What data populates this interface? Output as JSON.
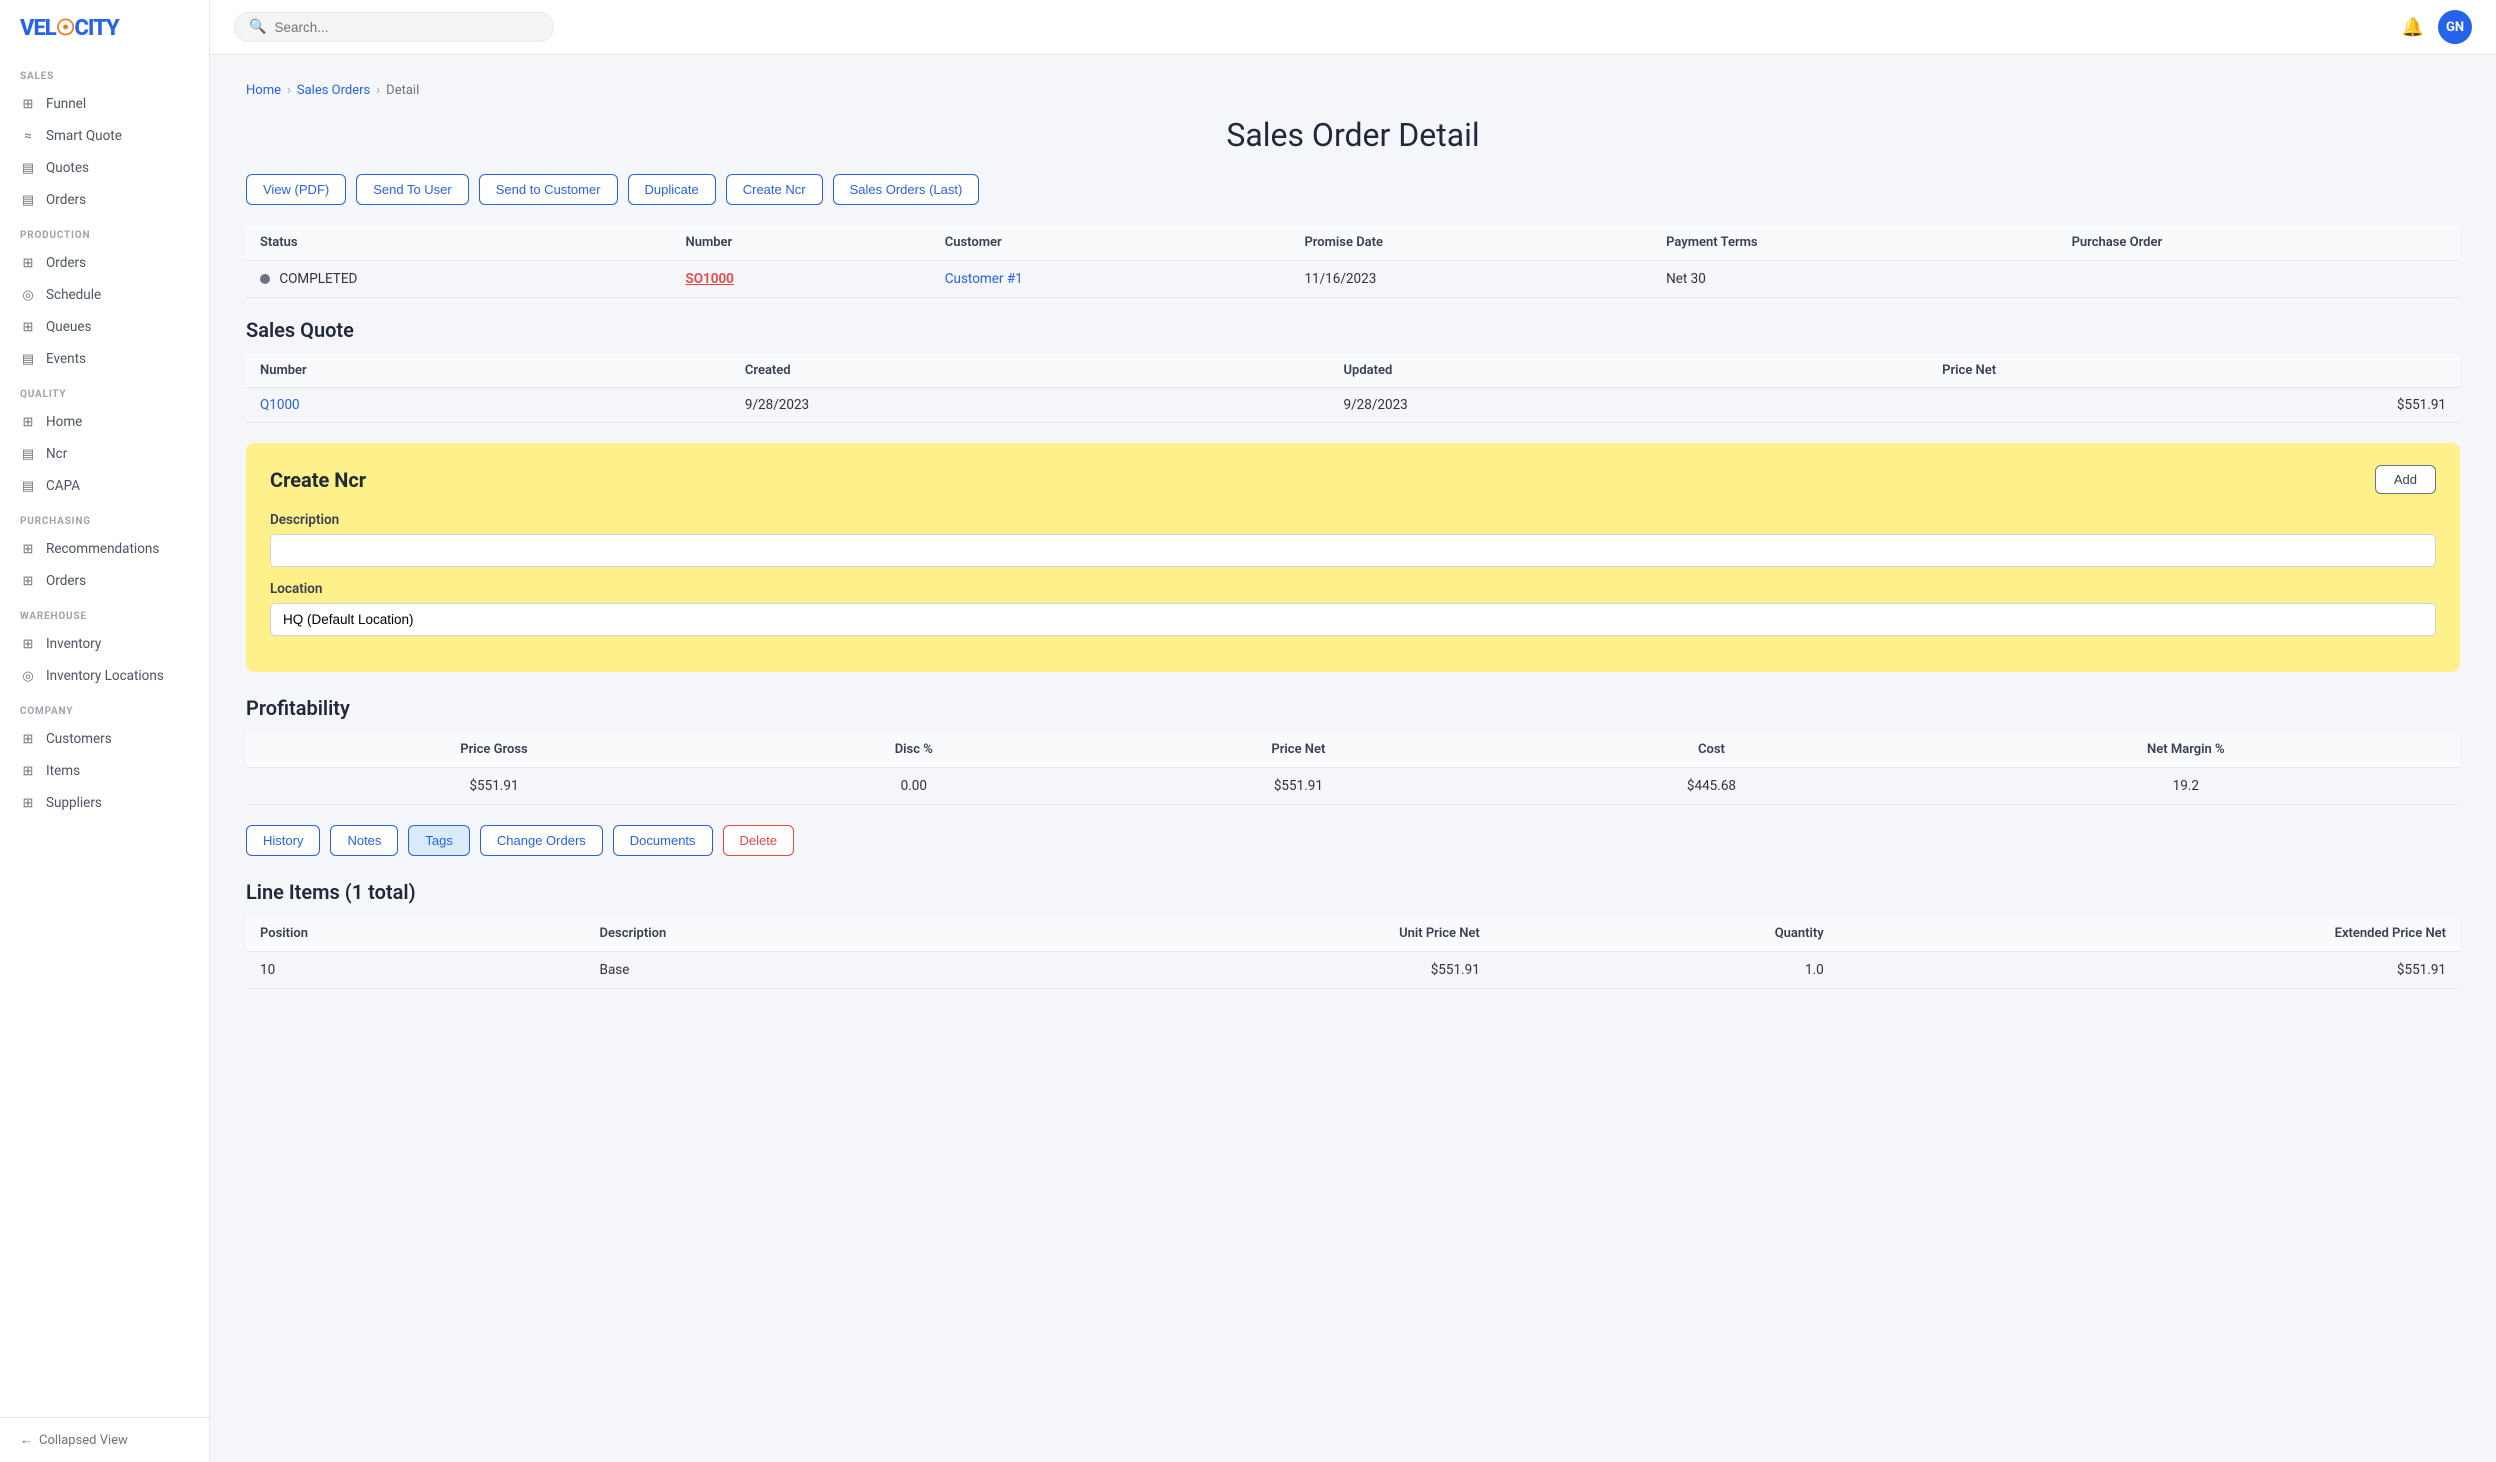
{
  "app": {
    "logo": "VEL",
    "logo_accent": "☉",
    "logo_full": "VELOCITY"
  },
  "topnav": {
    "search_placeholder": "Search...",
    "avatar_initials": "GN"
  },
  "sidebar": {
    "sections": [
      {
        "label": "SALES",
        "items": [
          {
            "id": "funnel",
            "label": "Funnel",
            "icon": "⊞"
          },
          {
            "id": "smart-quote",
            "label": "Smart Quote",
            "icon": "≈"
          },
          {
            "id": "quotes",
            "label": "Quotes",
            "icon": "▤"
          },
          {
            "id": "orders",
            "label": "Orders",
            "icon": "▤"
          }
        ]
      },
      {
        "label": "PRODUCTION",
        "items": [
          {
            "id": "prod-orders",
            "label": "Orders",
            "icon": "⊞"
          },
          {
            "id": "schedule",
            "label": "Schedule",
            "icon": "◎"
          },
          {
            "id": "queues",
            "label": "Queues",
            "icon": "⊞"
          },
          {
            "id": "events",
            "label": "Events",
            "icon": "▤"
          }
        ]
      },
      {
        "label": "QUALITY",
        "items": [
          {
            "id": "quality-home",
            "label": "Home",
            "icon": "⊞"
          },
          {
            "id": "ncr",
            "label": "Ncr",
            "icon": "▤"
          },
          {
            "id": "capa",
            "label": "CAPA",
            "icon": "▤"
          }
        ]
      },
      {
        "label": "PURCHASING",
        "items": [
          {
            "id": "recommendations",
            "label": "Recommendations",
            "icon": "⊞"
          },
          {
            "id": "purch-orders",
            "label": "Orders",
            "icon": "⊞"
          }
        ]
      },
      {
        "label": "WAREHOUSE",
        "items": [
          {
            "id": "inventory",
            "label": "Inventory",
            "icon": "⊞"
          },
          {
            "id": "inventory-locations",
            "label": "Inventory Locations",
            "icon": "◎"
          }
        ]
      },
      {
        "label": "COMPANY",
        "items": [
          {
            "id": "customers",
            "label": "Customers",
            "icon": "⊞"
          },
          {
            "id": "items",
            "label": "Items",
            "icon": "⊞"
          },
          {
            "id": "suppliers",
            "label": "Suppliers",
            "icon": "⊞"
          }
        ]
      }
    ],
    "collapsed_label": "Collapsed View"
  },
  "breadcrumb": {
    "home": "Home",
    "sales_orders": "Sales Orders",
    "current": "Detail"
  },
  "page": {
    "title": "Sales Order Detail"
  },
  "action_buttons": [
    {
      "id": "view-pdf",
      "label": "View (PDF)"
    },
    {
      "id": "send-to-user",
      "label": "Send To User"
    },
    {
      "id": "send-to-customer",
      "label": "Send to Customer"
    },
    {
      "id": "duplicate",
      "label": "Duplicate"
    },
    {
      "id": "create-ncr",
      "label": "Create Ncr"
    },
    {
      "id": "sales-orders-last",
      "label": "Sales Orders (Last)"
    }
  ],
  "order_table": {
    "headers": [
      "Status",
      "Number",
      "Customer",
      "Promise Date",
      "Payment Terms",
      "Purchase Order"
    ],
    "row": {
      "status": "COMPLETED",
      "number": "SO1000",
      "customer": "Customer #1",
      "promise_date": "11/16/2023",
      "payment_terms": "Net 30",
      "purchase_order": ""
    }
  },
  "sales_quote": {
    "title": "Sales Quote",
    "headers": [
      "Number",
      "Created",
      "Updated",
      "Price Net"
    ],
    "row": {
      "number": "Q1000",
      "created": "9/28/2023",
      "updated": "9/28/2023",
      "price_net": "$551.91"
    }
  },
  "create_ncr": {
    "title": "Create Ncr",
    "add_button": "Add",
    "description_label": "Description",
    "description_placeholder": "",
    "location_label": "Location",
    "location_value": "HQ (Default Location)"
  },
  "profitability": {
    "title": "Profitability",
    "headers": [
      "Price Gross",
      "Disc %",
      "Price Net",
      "Cost",
      "Net Margin %"
    ],
    "row": {
      "price_gross": "$551.91",
      "disc_pct": "0.00",
      "price_net": "$551.91",
      "cost": "$445.68",
      "net_margin_pct": "19.2"
    }
  },
  "bottom_buttons": [
    {
      "id": "history-btn",
      "label": "History"
    },
    {
      "id": "notes-btn",
      "label": "Notes"
    },
    {
      "id": "tags-btn",
      "label": "Tags",
      "active": true
    },
    {
      "id": "change-orders-btn",
      "label": "Change Orders"
    },
    {
      "id": "documents-btn",
      "label": "Documents"
    },
    {
      "id": "delete-btn",
      "label": "Delete",
      "danger": true
    }
  ],
  "line_items": {
    "title": "Line Items (1 total)",
    "headers": [
      "Position",
      "Description",
      "Unit Price Net",
      "Quantity",
      "Extended Price Net"
    ],
    "rows": [
      {
        "position": "10",
        "description": "Base",
        "unit_price_net": "$551.91",
        "quantity": "1.0",
        "extended_price_net": "$551.91"
      }
    ]
  }
}
